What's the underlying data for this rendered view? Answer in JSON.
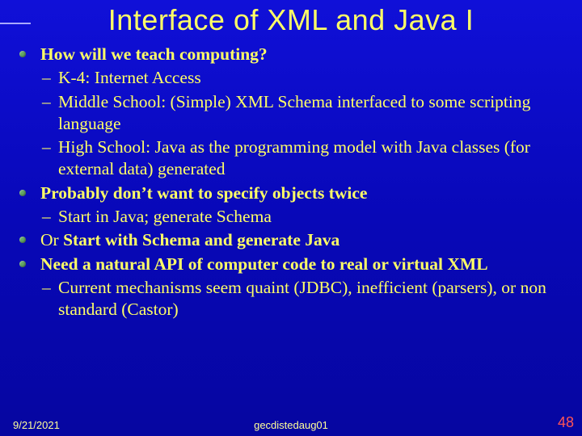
{
  "title": "Interface of XML and Java I",
  "bullets": [
    {
      "lead": "How will we teach computing?",
      "sub": [
        "K-4: Internet Access",
        "Middle School: (Simple) XML Schema interfaced to some scripting language",
        "High School: Java as the programming model with Java classes (for external data) generated"
      ]
    },
    {
      "lead": "Probably don’t want to specify objects twice",
      "sub": [
        "Start in Java; generate Schema"
      ]
    },
    {
      "lead_prefix": "Or ",
      "lead": "Start with Schema and generate Java",
      "sub": []
    },
    {
      "lead": "Need a natural API of computer code to real or virtual XML",
      "sub": [
        "Current mechanisms seem quaint (JDBC), inefficient (parsers), or non standard (Castor)"
      ]
    }
  ],
  "footer": {
    "date": "9/21/2021",
    "center": "gecdistedaug01",
    "page": "48"
  }
}
